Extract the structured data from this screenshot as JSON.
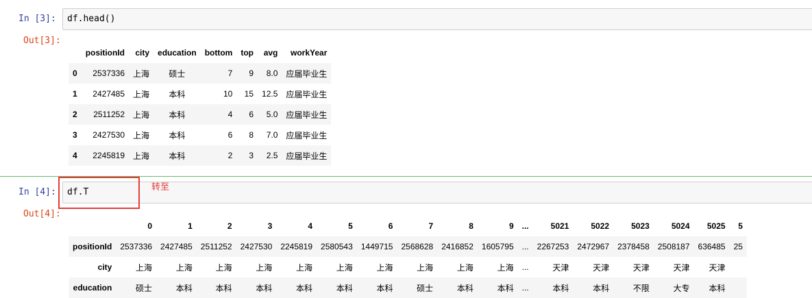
{
  "cell1": {
    "in_prompt": "In  [3]:",
    "code": "df.head()",
    "out_prompt": "Out[3]:",
    "table": {
      "columns": [
        "",
        "positionId",
        "city",
        "education",
        "bottom",
        "top",
        "avg",
        "workYear"
      ],
      "rows": [
        [
          "0",
          "2537336",
          "上海",
          "硕士",
          "7",
          "9",
          "8.0",
          "应届毕业生"
        ],
        [
          "1",
          "2427485",
          "上海",
          "本科",
          "10",
          "15",
          "12.5",
          "应届毕业生"
        ],
        [
          "2",
          "2511252",
          "上海",
          "本科",
          "4",
          "6",
          "5.0",
          "应届毕业生"
        ],
        [
          "3",
          "2427530",
          "上海",
          "本科",
          "6",
          "8",
          "7.0",
          "应届毕业生"
        ],
        [
          "4",
          "2245819",
          "上海",
          "本科",
          "2",
          "3",
          "2.5",
          "应届毕业生"
        ]
      ]
    }
  },
  "cell2": {
    "in_prompt": "In  [4]:",
    "code": "df.T",
    "annotation": "转至",
    "out_prompt": "Out[4]:",
    "table": {
      "columns": [
        "",
        "0",
        "1",
        "2",
        "3",
        "4",
        "5",
        "6",
        "7",
        "8",
        "9",
        "...",
        "5021",
        "5022",
        "5023",
        "5024",
        "5025",
        "5"
      ],
      "rows": [
        [
          "positionId",
          "2537336",
          "2427485",
          "2511252",
          "2427530",
          "2245819",
          "2580543",
          "1449715",
          "2568628",
          "2416852",
          "1605795",
          "...",
          "2267253",
          "2472967",
          "2378458",
          "2508187",
          "636485",
          "25"
        ],
        [
          "city",
          "上海",
          "上海",
          "上海",
          "上海",
          "上海",
          "上海",
          "上海",
          "上海",
          "上海",
          "上海",
          "...",
          "天津",
          "天津",
          "天津",
          "天津",
          "天津",
          ""
        ],
        [
          "education",
          "硕士",
          "本科",
          "本科",
          "本科",
          "本科",
          "本科",
          "本科",
          "硕士",
          "本科",
          "本科",
          "...",
          "本科",
          "本科",
          "不限",
          "大专",
          "本科",
          ""
        ]
      ]
    }
  },
  "colors": {
    "in_prompt": "#303f9f",
    "out_prompt": "#d84315",
    "highlight": "#e53935",
    "divider": "#66bb6a"
  }
}
